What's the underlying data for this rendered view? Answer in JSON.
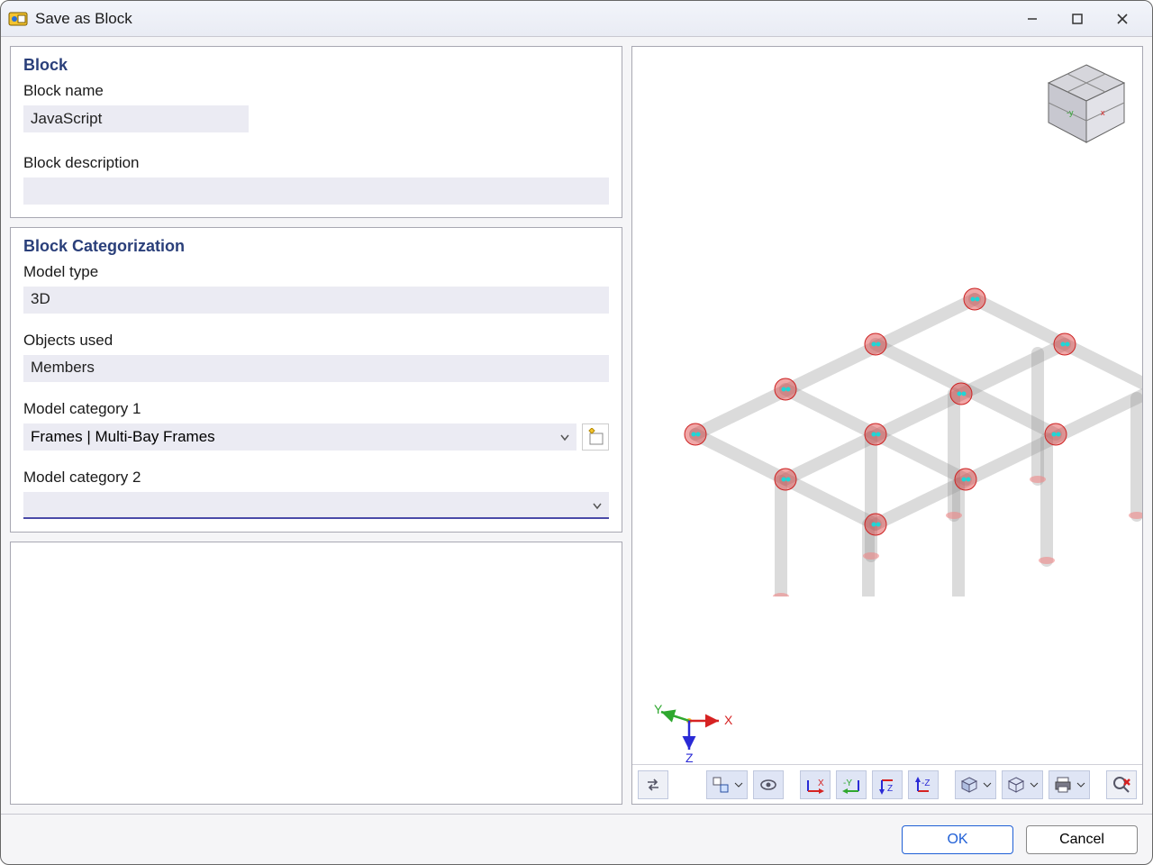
{
  "window": {
    "title": "Save as Block"
  },
  "block": {
    "section_title": "Block",
    "name_label": "Block name",
    "name_value": "JavaScript",
    "desc_label": "Block description",
    "desc_value": ""
  },
  "categorization": {
    "section_title": "Block Categorization",
    "model_type_label": "Model type",
    "model_type_value": "3D",
    "objects_used_label": "Objects used",
    "objects_used_value": "Members",
    "cat1_label": "Model category 1",
    "cat1_value": "Frames | Multi-Bay Frames",
    "cat2_label": "Model category 2",
    "cat2_value": ""
  },
  "axes": {
    "x": "X",
    "y": "Y",
    "z": "Z"
  },
  "toolbar_icons": {
    "swap": "swap-icon",
    "units": "units-dropdown-icon",
    "visibility": "visibility-icon",
    "axis_x": "axis-x-icon",
    "axis_y": "axis-y-icon",
    "axis_z_down": "axis-z-down-icon",
    "axis_z_up": "axis-z-up-icon",
    "box": "box-view-icon",
    "wireframe": "wireframe-icon",
    "print": "print-icon",
    "find": "find-delete-icon"
  },
  "footer": {
    "ok": "OK",
    "cancel": "Cancel"
  },
  "colors": {
    "accent": "#1f5fd6",
    "axis_x": "#d62222",
    "axis_y": "#2fa82f",
    "axis_z": "#2a2ad6"
  }
}
